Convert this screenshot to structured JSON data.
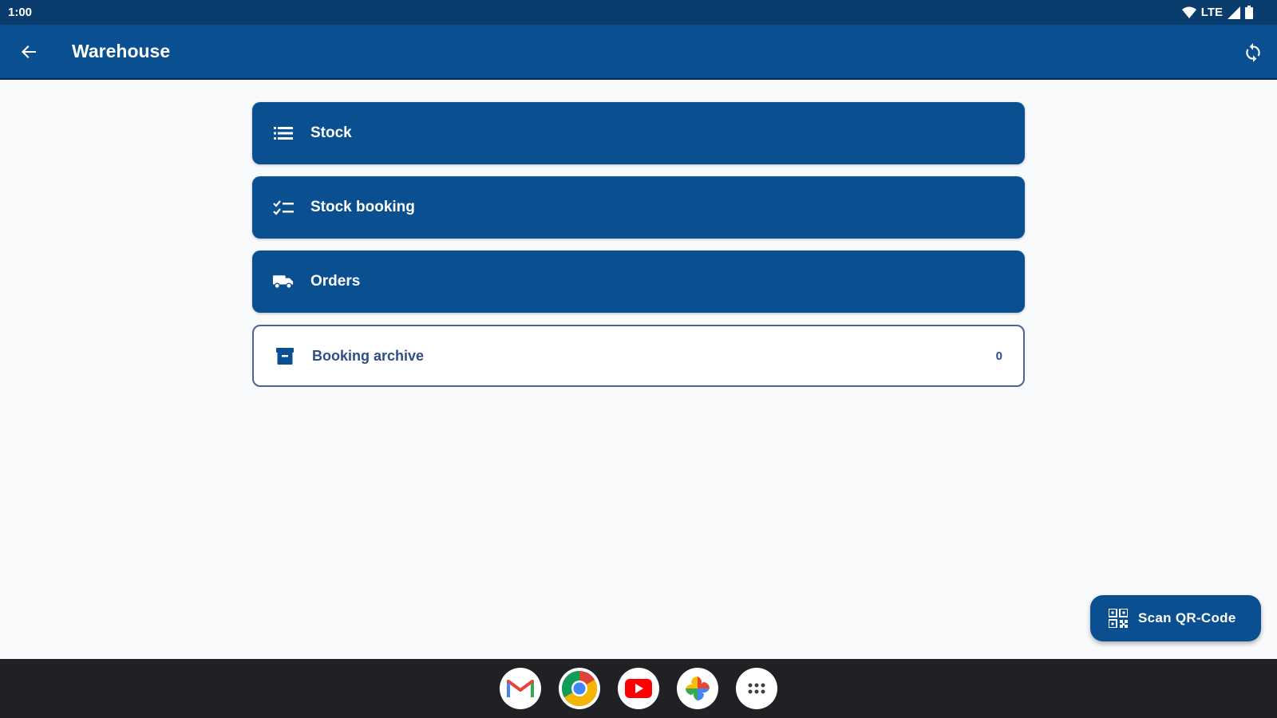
{
  "status_bar": {
    "time": "1:00",
    "network": "LTE"
  },
  "app_bar": {
    "title": "Warehouse"
  },
  "menu": {
    "items": [
      {
        "label": "Stock",
        "icon": "list-icon"
      },
      {
        "label": "Stock booking",
        "icon": "checklist-icon"
      },
      {
        "label": "Orders",
        "icon": "truck-icon"
      },
      {
        "label": "Booking archive",
        "icon": "archive-icon",
        "count": "0"
      }
    ]
  },
  "fab": {
    "label": "Scan QR-Code",
    "icon": "qr-code-icon"
  },
  "dock": {
    "apps": [
      "gmail-icon",
      "chrome-icon",
      "youtube-icon",
      "photos-icon",
      "app-drawer-icon"
    ]
  },
  "colors": {
    "primary": "#0a5091",
    "status_bar": "#0a3d6e",
    "outline": "#4a6496",
    "background": "#f9fafc",
    "taskbar": "#202124"
  }
}
